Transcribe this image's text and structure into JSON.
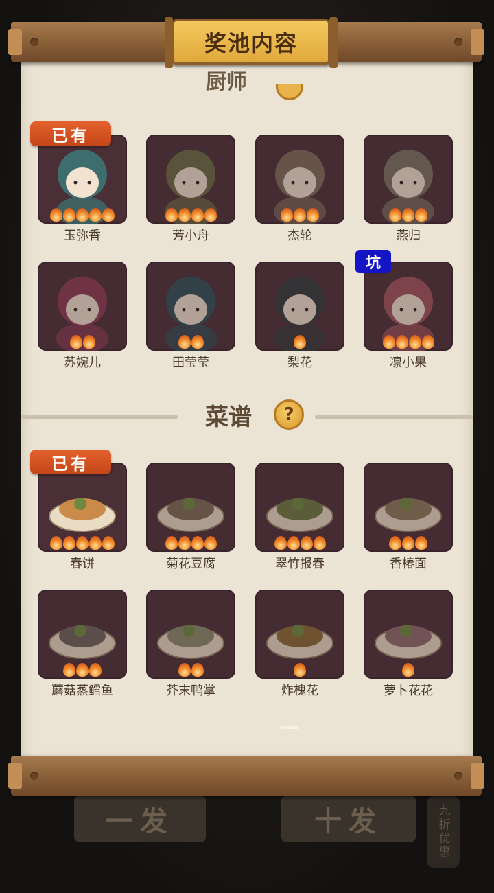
{
  "window": {
    "title": "奖池内容"
  },
  "background": {
    "btn_single": "一发",
    "btn_ten": "十发",
    "side_tag": "九折优惠"
  },
  "top_section": {
    "partial_heading": "厨师"
  },
  "chefs": [
    {
      "name": "玉弥香",
      "stars": 5,
      "owned": true,
      "badge": "已有",
      "color": "#3e6d6e"
    },
    {
      "name": "芳小舟",
      "stars": 4,
      "owned": false,
      "color": "#6a6a42"
    },
    {
      "name": "杰轮",
      "stars": 3,
      "owned": false,
      "color": "#7d6a58"
    },
    {
      "name": "燕归",
      "stars": 3,
      "owned": false,
      "color": "#7a7060"
    },
    {
      "name": "苏婉儿",
      "stars": 2,
      "owned": false,
      "color": "#8a3a52"
    },
    {
      "name": "田莹莹",
      "stars": 2,
      "owned": false,
      "color": "#2d4f55"
    },
    {
      "name": "梨花",
      "stars": 1,
      "owned": false,
      "color": "#2f3a3a"
    },
    {
      "name": "凛小果",
      "stars": 4,
      "owned": false,
      "badge_pit": "坑",
      "color": "#a0525a"
    }
  ],
  "recipes_section": {
    "heading": "菜谱",
    "help_icon": "question-icon"
  },
  "recipes": [
    {
      "name": "春饼",
      "stars": 5,
      "owned": true,
      "badge": "已有",
      "color": "#c98a4a"
    },
    {
      "name": "菊花豆腐",
      "stars": 4,
      "owned": false,
      "color": "#7c6a52"
    },
    {
      "name": "翠竹报春",
      "stars": 4,
      "owned": false,
      "color": "#6a7a3e"
    },
    {
      "name": "香椿面",
      "stars": 3,
      "owned": false,
      "color": "#8a7a5a"
    },
    {
      "name": "蘑菇蒸鳕鱼",
      "stars": 3,
      "owned": false,
      "color": "#6c6258"
    },
    {
      "name": "芥末鸭掌",
      "stars": 2,
      "owned": false,
      "color": "#8a8a6a"
    },
    {
      "name": "炸槐花",
      "stars": 1,
      "owned": false,
      "color": "#8a6a32"
    },
    {
      "name": "萝卜花花",
      "stars": 1,
      "owned": false,
      "color": "#8e6a6a"
    }
  ]
}
